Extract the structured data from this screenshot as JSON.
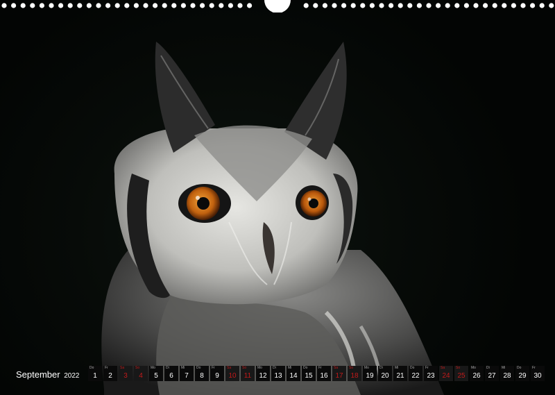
{
  "calendar": {
    "month": "September",
    "year": "2022",
    "days": [
      {
        "wd": "Do",
        "num": "1",
        "weekend": false
      },
      {
        "wd": "Fr",
        "num": "2",
        "weekend": false
      },
      {
        "wd": "Sa",
        "num": "3",
        "weekend": true
      },
      {
        "wd": "So",
        "num": "4",
        "weekend": true
      },
      {
        "wd": "Mo",
        "num": "5",
        "weekend": false
      },
      {
        "wd": "Di",
        "num": "6",
        "weekend": false
      },
      {
        "wd": "Mi",
        "num": "7",
        "weekend": false
      },
      {
        "wd": "Do",
        "num": "8",
        "weekend": false
      },
      {
        "wd": "Fr",
        "num": "9",
        "weekend": false
      },
      {
        "wd": "Sa",
        "num": "10",
        "weekend": true
      },
      {
        "wd": "So",
        "num": "11",
        "weekend": true
      },
      {
        "wd": "Mo",
        "num": "12",
        "weekend": false
      },
      {
        "wd": "Di",
        "num": "13",
        "weekend": false
      },
      {
        "wd": "Mi",
        "num": "14",
        "weekend": false
      },
      {
        "wd": "Do",
        "num": "15",
        "weekend": false
      },
      {
        "wd": "Fr",
        "num": "16",
        "weekend": false
      },
      {
        "wd": "Sa",
        "num": "17",
        "weekend": true
      },
      {
        "wd": "So",
        "num": "18",
        "weekend": true
      },
      {
        "wd": "Mo",
        "num": "19",
        "weekend": false
      },
      {
        "wd": "Di",
        "num": "20",
        "weekend": false
      },
      {
        "wd": "Mi",
        "num": "21",
        "weekend": false
      },
      {
        "wd": "Do",
        "num": "22",
        "weekend": false
      },
      {
        "wd": "Fr",
        "num": "23",
        "weekend": false
      },
      {
        "wd": "Sa",
        "num": "24",
        "weekend": true
      },
      {
        "wd": "So",
        "num": "25",
        "weekend": true
      },
      {
        "wd": "Mo",
        "num": "26",
        "weekend": false
      },
      {
        "wd": "Di",
        "num": "27",
        "weekend": false
      },
      {
        "wd": "Mi",
        "num": "28",
        "weekend": false
      },
      {
        "wd": "Do",
        "num": "29",
        "weekend": false
      },
      {
        "wd": "Fr",
        "num": "30",
        "weekend": false
      }
    ]
  },
  "colors": {
    "background": "#050806",
    "eye": "#d9781a",
    "weekend": "#c21a1a",
    "text": "#ffffff"
  }
}
